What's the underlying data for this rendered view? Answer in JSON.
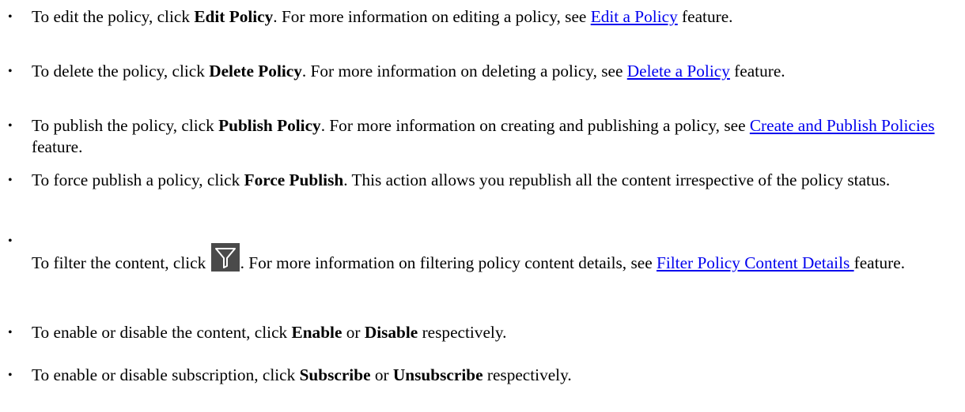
{
  "items": [
    {
      "pre": "To edit the policy, click ",
      "bold": "Edit Policy",
      "mid": ". For more information on editing a policy, see ",
      "link": "Edit a Policy",
      "post": " feature."
    },
    {
      "pre": "To delete the policy, click ",
      "bold": "Delete Policy",
      "mid": ". For more information on deleting a policy, see ",
      "link": "Delete a Policy",
      "post": " feature."
    },
    {
      "pre": "To publish the policy, click ",
      "bold": "Publish Policy",
      "mid": ". For more information on creating and publishing a policy, see ",
      "link": "Create and Publish Policies",
      "post": " feature."
    },
    {
      "pre": "To force publish a policy, click ",
      "bold": "Force Publish",
      "post": ". This action allows you republish all the content irrespective of the policy status."
    },
    {
      "pre": "To filter the content, click ",
      "icon": "filter-icon",
      "mid": ". For more information on filtering policy content details, see ",
      "link": "Filter Policy Content Details ",
      "post": "feature."
    },
    {
      "pre": "To enable or disable the content, click ",
      "bold1": "Enable",
      "mid": " or ",
      "bold2": "Disable",
      "post": " respectively."
    },
    {
      "pre": "To enable or disable subscription, click ",
      "bold1": "Subscribe",
      "mid": " or ",
      "bold2": "Unsubscribe",
      "post": " respectively."
    }
  ],
  "bullet": "•",
  "colors": {
    "link": "#0000ee",
    "icon_bg": "#4a4a4a",
    "icon_stroke": "#ffffff"
  }
}
